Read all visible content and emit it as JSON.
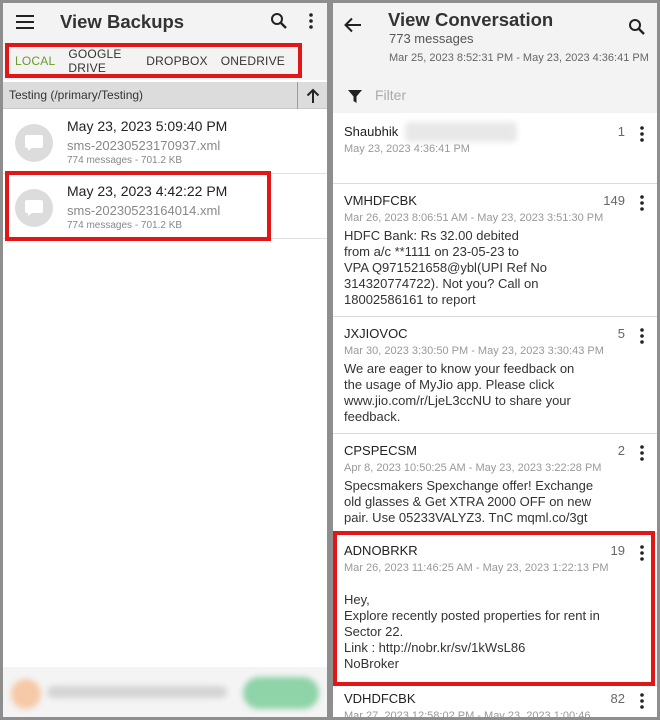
{
  "left": {
    "title": "View Backups",
    "tabs": [
      {
        "label": "LOCAL",
        "active": true
      },
      {
        "label": "GOOGLE DRIVE",
        "active": false
      },
      {
        "label": "DROPBOX",
        "active": false
      },
      {
        "label": "ONEDRIVE",
        "active": false
      }
    ],
    "path": "Testing (/primary/Testing)",
    "backups": [
      {
        "date": "May 23, 2023 5:09:40 PM",
        "file": "sms-20230523170937.xml",
        "meta": "774 messages - 701.2 KB"
      },
      {
        "date": "May 23, 2023 4:42:22 PM",
        "file": "sms-20230523164014.xml",
        "meta": "774 messages - 701.2 KB"
      }
    ]
  },
  "right": {
    "title": "View Conversation",
    "subtitle": "773 messages",
    "range": "Mar 25, 2023 8:52:31 PM - May 23, 2023 4:36:41 PM",
    "filter_placeholder": "Filter",
    "conversations": [
      {
        "sender": "Shaubhik",
        "count": "1",
        "range": "May 23, 2023 4:36:41 PM",
        "body": ""
      },
      {
        "sender": "VMHDFCBK",
        "count": "149",
        "range": "Mar 26, 2023 8:06:51 AM - May 23, 2023 3:51:30 PM",
        "body": "HDFC Bank: Rs 32.00 debited\nfrom a/c **1111 on 23-05-23 to\nVPA Q971521658@ybl(UPI Ref No\n314320774722). Not you? Call on\n18002586161 to report"
      },
      {
        "sender": "JXJIOVOC",
        "count": "5",
        "range": "Mar 30, 2023 3:30:50 PM - May 23, 2023 3:30:43 PM",
        "body": "We are eager to know your feedback on\nthe usage of MyJio app. Please click\nwww.jio.com/r/LjeL3ccNU to share your\nfeedback."
      },
      {
        "sender": "CPSPECSM",
        "count": "2",
        "range": "Apr 8, 2023 10:50:25 AM - May 23, 2023 3:22:28 PM",
        "body": "Specsmakers Spexchange offer! Exchange\nold glasses & Get XTRA 2000 OFF on new\npair. Use 05233VALYZ3. TnC mqml.co/3gt"
      },
      {
        "sender": "ADNOBRKR",
        "count": "19",
        "range": "Mar 26, 2023 11:46:25 AM - May 23, 2023 1:22:13 PM",
        "body": "Hey,\nExplore recently posted properties for rent in\nSector 22.\nLink : http://nobr.kr/sv/1kWsL86\nNoBroker"
      },
      {
        "sender": "VDHDFCBK",
        "count": "82",
        "range": "Mar 27, 2023 12:58:02 PM - May 23, 2023 1:00:46",
        "body": ""
      }
    ]
  },
  "colors": {
    "highlight": "#e11616",
    "active_tab": "#6b9a2e",
    "appbar": "#f3f3f3"
  }
}
